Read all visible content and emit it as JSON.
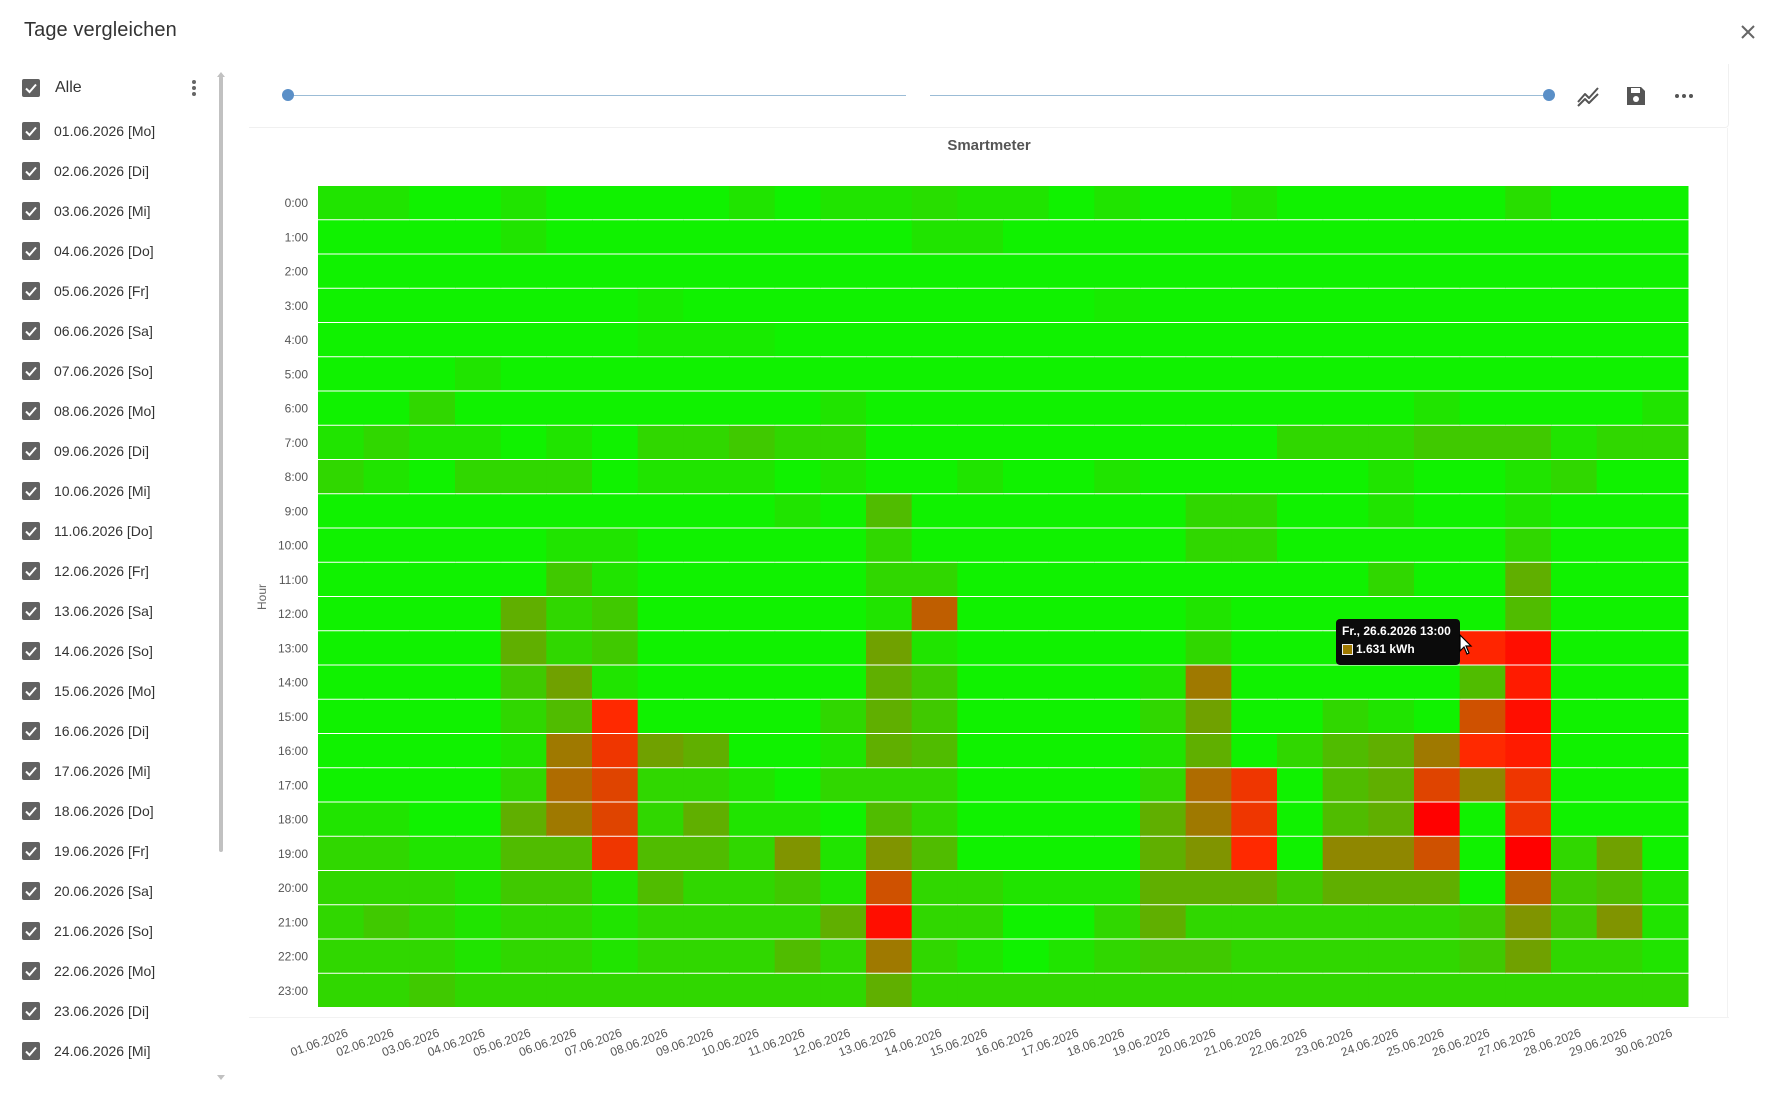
{
  "dialog": {
    "title": "Tage vergleichen",
    "close_icon": "close-icon"
  },
  "sidebar": {
    "all_label": "Alle",
    "all_checked": true,
    "more_icon": "more-vert-icon",
    "items": [
      {
        "label": "01.06.2026 [Mo]",
        "checked": true
      },
      {
        "label": "02.06.2026 [Di]",
        "checked": true
      },
      {
        "label": "03.06.2026 [Mi]",
        "checked": true
      },
      {
        "label": "04.06.2026 [Do]",
        "checked": true
      },
      {
        "label": "05.06.2026 [Fr]",
        "checked": true
      },
      {
        "label": "06.06.2026 [Sa]",
        "checked": true
      },
      {
        "label": "07.06.2026 [So]",
        "checked": true
      },
      {
        "label": "08.06.2026 [Mo]",
        "checked": true
      },
      {
        "label": "09.06.2026 [Di]",
        "checked": true
      },
      {
        "label": "10.06.2026 [Mi]",
        "checked": true
      },
      {
        "label": "11.06.2026 [Do]",
        "checked": true
      },
      {
        "label": "12.06.2026 [Fr]",
        "checked": true
      },
      {
        "label": "13.06.2026 [Sa]",
        "checked": true
      },
      {
        "label": "14.06.2026 [So]",
        "checked": true
      },
      {
        "label": "15.06.2026 [Mo]",
        "checked": true
      },
      {
        "label": "16.06.2026 [Di]",
        "checked": true
      },
      {
        "label": "17.06.2026 [Mi]",
        "checked": true
      },
      {
        "label": "18.06.2026 [Do]",
        "checked": true
      },
      {
        "label": "19.06.2026 [Fr]",
        "checked": true
      },
      {
        "label": "20.06.2026 [Sa]",
        "checked": true
      },
      {
        "label": "21.06.2026 [So]",
        "checked": true
      },
      {
        "label": "22.06.2026 [Mo]",
        "checked": true
      },
      {
        "label": "23.06.2026 [Di]",
        "checked": true
      },
      {
        "label": "24.06.2026 [Mi]",
        "checked": true
      }
    ]
  },
  "toolbar": {
    "range_start": 0,
    "range_end": 1,
    "icons": [
      "line-chart-icon",
      "save-icon",
      "more-horiz-icon"
    ]
  },
  "tooltip": {
    "title": "Fr., 26.6.2026 13:00",
    "value": "1.631 kWh"
  },
  "colors": {
    "low": "#00ff00",
    "high": "#ff0000",
    "accent": "#5a8fc7",
    "checkbox": "#616161"
  },
  "chart_data": {
    "type": "heatmap",
    "title": "Smartmeter",
    "ylabel": "Hour",
    "xlabel": "",
    "unit": "kWh",
    "color_scale": {
      "min": 0,
      "max": 2.0
    },
    "x_categories": [
      "01.06.2026",
      "02.06.2026",
      "03.06.2026",
      "04.06.2026",
      "05.06.2026",
      "06.06.2026",
      "07.06.2026",
      "08.06.2026",
      "09.06.2026",
      "10.06.2026",
      "11.06.2026",
      "12.06.2026",
      "13.06.2026",
      "14.06.2026",
      "15.06.2026",
      "16.06.2026",
      "17.06.2026",
      "18.06.2026",
      "19.06.2026",
      "20.06.2026",
      "21.06.2026",
      "22.06.2026",
      "23.06.2026",
      "24.06.2026",
      "25.06.2026",
      "26.06.2026",
      "27.06.2026",
      "28.06.2026",
      "29.06.2026",
      "30.06.2026"
    ],
    "y_categories": [
      "0:00",
      "1:00",
      "2:00",
      "3:00",
      "4:00",
      "5:00",
      "6:00",
      "7:00",
      "8:00",
      "9:00",
      "10:00",
      "11:00",
      "12:00",
      "13:00",
      "14:00",
      "15:00",
      "16:00",
      "17:00",
      "18:00",
      "19:00",
      "20:00",
      "21:00",
      "22:00",
      "23:00"
    ],
    "values": [
      [
        0.2,
        0.2,
        0.1,
        0.1,
        0.2,
        0.1,
        0.1,
        0.1,
        0.1,
        0.2,
        0.1,
        0.2,
        0.2,
        0.25,
        0.2,
        0.2,
        0.1,
        0.2,
        0.1,
        0.1,
        0.2,
        0.1,
        0.1,
        0.1,
        0.1,
        0.1,
        0.25,
        0.1,
        0.1,
        0.1
      ],
      [
        0.1,
        0.1,
        0.1,
        0.1,
        0.2,
        0.1,
        0.1,
        0.1,
        0.1,
        0.1,
        0.1,
        0.1,
        0.1,
        0.2,
        0.2,
        0.1,
        0.1,
        0.1,
        0.1,
        0.1,
        0.1,
        0.1,
        0.1,
        0.1,
        0.1,
        0.1,
        0.1,
        0.1,
        0.1,
        0.1
      ],
      [
        0.1,
        0.1,
        0.1,
        0.1,
        0.1,
        0.1,
        0.1,
        0.1,
        0.1,
        0.1,
        0.1,
        0.1,
        0.1,
        0.1,
        0.1,
        0.1,
        0.1,
        0.1,
        0.1,
        0.1,
        0.1,
        0.1,
        0.1,
        0.1,
        0.1,
        0.1,
        0.1,
        0.1,
        0.1,
        0.1
      ],
      [
        0.1,
        0.1,
        0.1,
        0.1,
        0.1,
        0.1,
        0.1,
        0.15,
        0.1,
        0.1,
        0.1,
        0.1,
        0.1,
        0.1,
        0.1,
        0.1,
        0.1,
        0.15,
        0.1,
        0.1,
        0.1,
        0.1,
        0.1,
        0.1,
        0.1,
        0.1,
        0.1,
        0.1,
        0.1,
        0.1
      ],
      [
        0.1,
        0.1,
        0.1,
        0.1,
        0.1,
        0.1,
        0.1,
        0.15,
        0.15,
        0.15,
        0.1,
        0.1,
        0.1,
        0.1,
        0.1,
        0.1,
        0.1,
        0.1,
        0.1,
        0.1,
        0.1,
        0.1,
        0.1,
        0.1,
        0.1,
        0.1,
        0.1,
        0.1,
        0.1,
        0.1
      ],
      [
        0.1,
        0.1,
        0.1,
        0.2,
        0.1,
        0.1,
        0.1,
        0.1,
        0.1,
        0.1,
        0.1,
        0.1,
        0.1,
        0.1,
        0.1,
        0.1,
        0.1,
        0.1,
        0.1,
        0.1,
        0.1,
        0.1,
        0.1,
        0.1,
        0.1,
        0.1,
        0.1,
        0.1,
        0.1,
        0.1
      ],
      [
        0.1,
        0.1,
        0.3,
        0.1,
        0.1,
        0.1,
        0.1,
        0.1,
        0.1,
        0.1,
        0.1,
        0.2,
        0.1,
        0.1,
        0.1,
        0.1,
        0.1,
        0.1,
        0.1,
        0.1,
        0.1,
        0.1,
        0.1,
        0.1,
        0.2,
        0.1,
        0.1,
        0.1,
        0.1,
        0.2
      ],
      [
        0.2,
        0.3,
        0.2,
        0.2,
        0.1,
        0.2,
        0.1,
        0.3,
        0.3,
        0.4,
        0.3,
        0.3,
        0.1,
        0.1,
        0.1,
        0.1,
        0.1,
        0.1,
        0.1,
        0.1,
        0.1,
        0.3,
        0.3,
        0.3,
        0.4,
        0.4,
        0.4,
        0.2,
        0.3,
        0.3
      ],
      [
        0.3,
        0.2,
        0.1,
        0.3,
        0.3,
        0.3,
        0.1,
        0.2,
        0.2,
        0.2,
        0.1,
        0.2,
        0.1,
        0.1,
        0.2,
        0.1,
        0.1,
        0.2,
        0.1,
        0.1,
        0.1,
        0.1,
        0.1,
        0.2,
        0.1,
        0.1,
        0.2,
        0.3,
        0.1,
        0.1
      ],
      [
        0.1,
        0.1,
        0.1,
        0.1,
        0.1,
        0.1,
        0.1,
        0.1,
        0.1,
        0.1,
        0.2,
        0.1,
        0.5,
        0.1,
        0.1,
        0.1,
        0.1,
        0.1,
        0.1,
        0.3,
        0.3,
        0.1,
        0.1,
        0.2,
        0.1,
        0.1,
        0.2,
        0.1,
        0.1,
        0.1
      ],
      [
        0.1,
        0.1,
        0.1,
        0.1,
        0.1,
        0.2,
        0.2,
        0.1,
        0.1,
        0.1,
        0.1,
        0.1,
        0.3,
        0.1,
        0.1,
        0.1,
        0.1,
        0.1,
        0.1,
        0.3,
        0.3,
        0.1,
        0.1,
        0.1,
        0.1,
        0.1,
        0.3,
        0.1,
        0.1,
        0.1
      ],
      [
        0.1,
        0.1,
        0.1,
        0.1,
        0.1,
        0.4,
        0.2,
        0.1,
        0.1,
        0.1,
        0.1,
        0.1,
        0.3,
        0.3,
        0.1,
        0.1,
        0.1,
        0.1,
        0.1,
        0.1,
        0.1,
        0.1,
        0.1,
        0.3,
        0.1,
        0.1,
        0.6,
        0.1,
        0.1,
        0.1
      ],
      [
        0.1,
        0.1,
        0.1,
        0.1,
        0.6,
        0.3,
        0.4,
        0.1,
        0.1,
        0.1,
        0.1,
        0.1,
        0.2,
        1.2,
        0.1,
        0.1,
        0.1,
        0.1,
        0.1,
        0.2,
        0.1,
        0.1,
        0.1,
        0.1,
        0.1,
        0.1,
        0.5,
        0.1,
        0.1,
        0.1
      ],
      [
        0.1,
        0.1,
        0.1,
        0.1,
        0.6,
        0.3,
        0.4,
        0.1,
        0.1,
        0.1,
        0.1,
        0.1,
        0.7,
        0.2,
        0.1,
        0.1,
        0.1,
        0.1,
        0.1,
        0.3,
        0.1,
        0.1,
        0.1,
        0.1,
        0.1,
        1.631,
        1.8,
        0.1,
        0.1,
        0.1
      ],
      [
        0.1,
        0.1,
        0.1,
        0.1,
        0.4,
        0.7,
        0.2,
        0.1,
        0.1,
        0.1,
        0.1,
        0.1,
        0.6,
        0.4,
        0.1,
        0.1,
        0.1,
        0.1,
        0.2,
        1.0,
        0.1,
        0.1,
        0.1,
        0.1,
        0.1,
        0.5,
        1.7,
        0.1,
        0.1,
        0.1
      ],
      [
        0.1,
        0.1,
        0.1,
        0.1,
        0.3,
        0.5,
        1.6,
        0.1,
        0.1,
        0.1,
        0.1,
        0.3,
        0.6,
        0.4,
        0.1,
        0.1,
        0.1,
        0.1,
        0.3,
        0.7,
        0.1,
        0.1,
        0.3,
        0.2,
        0.1,
        1.3,
        1.8,
        0.1,
        0.1,
        0.1
      ],
      [
        0.1,
        0.1,
        0.1,
        0.1,
        0.2,
        1.0,
        1.5,
        0.7,
        0.6,
        0.1,
        0.1,
        0.2,
        0.6,
        0.5,
        0.1,
        0.1,
        0.1,
        0.1,
        0.2,
        0.6,
        0.1,
        0.3,
        0.5,
        0.6,
        1.0,
        1.6,
        1.7,
        0.1,
        0.1,
        0.1
      ],
      [
        0.1,
        0.1,
        0.1,
        0.1,
        0.3,
        1.1,
        1.4,
        0.3,
        0.3,
        0.2,
        0.1,
        0.3,
        0.3,
        0.3,
        0.1,
        0.1,
        0.1,
        0.1,
        0.3,
        1.1,
        1.5,
        0.1,
        0.5,
        0.6,
        1.4,
        0.9,
        1.5,
        0.1,
        0.1,
        0.1
      ],
      [
        0.2,
        0.2,
        0.1,
        0.1,
        0.6,
        1.0,
        1.4,
        0.3,
        0.6,
        0.2,
        0.2,
        0.1,
        0.5,
        0.3,
        0.1,
        0.1,
        0.1,
        0.1,
        0.6,
        1.0,
        1.5,
        0.1,
        0.5,
        0.6,
        1.9,
        0.1,
        1.5,
        0.1,
        0.1,
        0.1
      ],
      [
        0.3,
        0.3,
        0.2,
        0.2,
        0.5,
        0.5,
        1.5,
        0.5,
        0.5,
        0.3,
        0.8,
        0.2,
        0.8,
        0.5,
        0.1,
        0.1,
        0.1,
        0.1,
        0.6,
        0.8,
        1.6,
        0.1,
        0.9,
        0.9,
        1.3,
        0.1,
        1.9,
        0.3,
        0.7,
        0.1
      ],
      [
        0.3,
        0.3,
        0.3,
        0.2,
        0.4,
        0.4,
        0.2,
        0.5,
        0.3,
        0.3,
        0.4,
        0.2,
        1.3,
        0.3,
        0.3,
        0.2,
        0.2,
        0.2,
        0.6,
        0.6,
        0.6,
        0.4,
        0.6,
        0.6,
        0.6,
        0.1,
        1.2,
        0.4,
        0.5,
        0.2
      ],
      [
        0.3,
        0.4,
        0.3,
        0.2,
        0.3,
        0.3,
        0.2,
        0.3,
        0.3,
        0.3,
        0.3,
        0.6,
        1.8,
        0.3,
        0.3,
        0.1,
        0.1,
        0.3,
        0.6,
        0.3,
        0.3,
        0.3,
        0.3,
        0.3,
        0.3,
        0.4,
        0.8,
        0.4,
        0.8,
        0.2
      ],
      [
        0.3,
        0.3,
        0.3,
        0.2,
        0.3,
        0.3,
        0.2,
        0.3,
        0.3,
        0.3,
        0.5,
        0.3,
        1.0,
        0.3,
        0.2,
        0.1,
        0.2,
        0.3,
        0.4,
        0.4,
        0.3,
        0.3,
        0.3,
        0.3,
        0.3,
        0.4,
        0.7,
        0.3,
        0.3,
        0.2
      ],
      [
        0.3,
        0.3,
        0.4,
        0.3,
        0.3,
        0.3,
        0.3,
        0.3,
        0.3,
        0.3,
        0.3,
        0.3,
        0.6,
        0.3,
        0.3,
        0.3,
        0.3,
        0.3,
        0.3,
        0.3,
        0.3,
        0.3,
        0.3,
        0.3,
        0.3,
        0.3,
        0.3,
        0.3,
        0.3,
        0.3
      ]
    ]
  }
}
